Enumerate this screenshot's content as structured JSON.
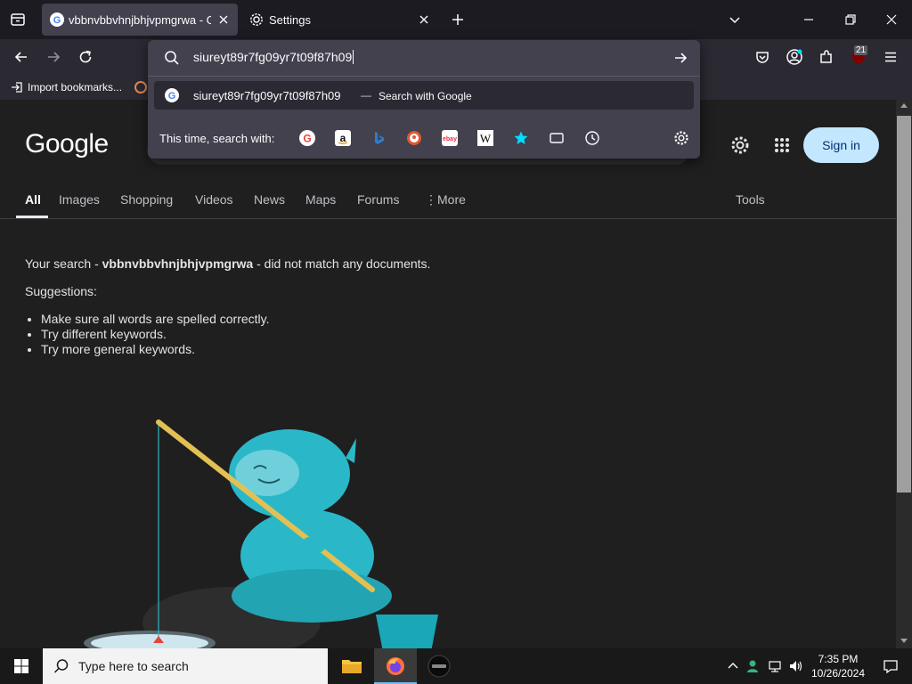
{
  "browser": {
    "tabs": [
      {
        "title": "vbbnvbbvhnjbhjvpmgrwa - Goo",
        "active": true
      },
      {
        "title": "Settings",
        "active": false
      }
    ],
    "url_input_value": "siureyt89r7fg09yr7t09f87h09",
    "extensions_badge": "21",
    "bookmarks": [
      {
        "label": "Import bookmarks..."
      }
    ]
  },
  "urlbar_dropdown": {
    "suggestion": {
      "query": "siureyt89r7fg09yr7t09f87h09",
      "separator": "—",
      "action": "Search with Google"
    },
    "engines_label": "This time, search with:",
    "engines": [
      "google-icon",
      "amazon-icon",
      "bing-icon",
      "duckduckgo-icon",
      "ebay-icon",
      "wikipedia-icon",
      "bookmarks-star-icon",
      "tabs-icon",
      "history-icon"
    ]
  },
  "google": {
    "logo": "Google",
    "signin": "Sign in",
    "tabs": [
      "All",
      "Images",
      "Shopping",
      "Videos",
      "News",
      "Maps",
      "Forums",
      "More",
      "Tools"
    ],
    "message_prefix": "Your search - ",
    "query": "vbbnvbbvhnjbhjvpmgrwa",
    "message_suffix": " - did not match any documents.",
    "suggestions_title": "Suggestions:",
    "suggestions": [
      "Make sure all words are spelled correctly.",
      "Try different keywords.",
      "Try more general keywords."
    ]
  },
  "taskbar": {
    "search_placeholder": "Type here to search",
    "time": "7:35 PM",
    "date": "10/26/2024"
  },
  "colors": {
    "page_bg": "#1f1f1f",
    "chrome_bg": "#2b2a33",
    "tabbar_bg": "#1c1b22",
    "accent_blue": "#8ab4f8",
    "signin_bg": "#c2e7ff",
    "yeti": "#2ab8c9"
  }
}
